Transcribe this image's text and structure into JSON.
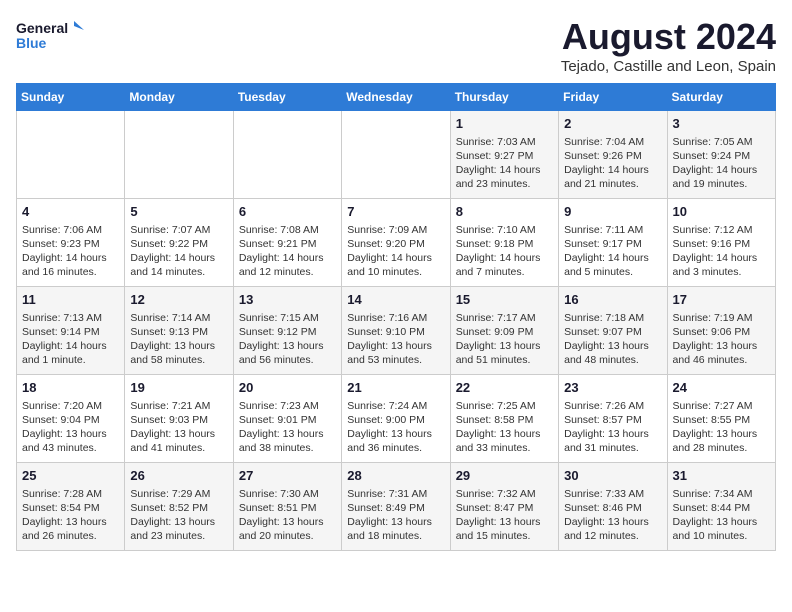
{
  "logo": {
    "line1": "General",
    "line2": "Blue"
  },
  "title": "August 2024",
  "subtitle": "Tejado, Castille and Leon, Spain",
  "days_of_week": [
    "Sunday",
    "Monday",
    "Tuesday",
    "Wednesday",
    "Thursday",
    "Friday",
    "Saturday"
  ],
  "weeks": [
    [
      {
        "day": "",
        "content": ""
      },
      {
        "day": "",
        "content": ""
      },
      {
        "day": "",
        "content": ""
      },
      {
        "day": "",
        "content": ""
      },
      {
        "day": "1",
        "content": "Sunrise: 7:03 AM\nSunset: 9:27 PM\nDaylight: 14 hours\nand 23 minutes."
      },
      {
        "day": "2",
        "content": "Sunrise: 7:04 AM\nSunset: 9:26 PM\nDaylight: 14 hours\nand 21 minutes."
      },
      {
        "day": "3",
        "content": "Sunrise: 7:05 AM\nSunset: 9:24 PM\nDaylight: 14 hours\nand 19 minutes."
      }
    ],
    [
      {
        "day": "4",
        "content": "Sunrise: 7:06 AM\nSunset: 9:23 PM\nDaylight: 14 hours\nand 16 minutes."
      },
      {
        "day": "5",
        "content": "Sunrise: 7:07 AM\nSunset: 9:22 PM\nDaylight: 14 hours\nand 14 minutes."
      },
      {
        "day": "6",
        "content": "Sunrise: 7:08 AM\nSunset: 9:21 PM\nDaylight: 14 hours\nand 12 minutes."
      },
      {
        "day": "7",
        "content": "Sunrise: 7:09 AM\nSunset: 9:20 PM\nDaylight: 14 hours\nand 10 minutes."
      },
      {
        "day": "8",
        "content": "Sunrise: 7:10 AM\nSunset: 9:18 PM\nDaylight: 14 hours\nand 7 minutes."
      },
      {
        "day": "9",
        "content": "Sunrise: 7:11 AM\nSunset: 9:17 PM\nDaylight: 14 hours\nand 5 minutes."
      },
      {
        "day": "10",
        "content": "Sunrise: 7:12 AM\nSunset: 9:16 PM\nDaylight: 14 hours\nand 3 minutes."
      }
    ],
    [
      {
        "day": "11",
        "content": "Sunrise: 7:13 AM\nSunset: 9:14 PM\nDaylight: 14 hours\nand 1 minute."
      },
      {
        "day": "12",
        "content": "Sunrise: 7:14 AM\nSunset: 9:13 PM\nDaylight: 13 hours\nand 58 minutes."
      },
      {
        "day": "13",
        "content": "Sunrise: 7:15 AM\nSunset: 9:12 PM\nDaylight: 13 hours\nand 56 minutes."
      },
      {
        "day": "14",
        "content": "Sunrise: 7:16 AM\nSunset: 9:10 PM\nDaylight: 13 hours\nand 53 minutes."
      },
      {
        "day": "15",
        "content": "Sunrise: 7:17 AM\nSunset: 9:09 PM\nDaylight: 13 hours\nand 51 minutes."
      },
      {
        "day": "16",
        "content": "Sunrise: 7:18 AM\nSunset: 9:07 PM\nDaylight: 13 hours\nand 48 minutes."
      },
      {
        "day": "17",
        "content": "Sunrise: 7:19 AM\nSunset: 9:06 PM\nDaylight: 13 hours\nand 46 minutes."
      }
    ],
    [
      {
        "day": "18",
        "content": "Sunrise: 7:20 AM\nSunset: 9:04 PM\nDaylight: 13 hours\nand 43 minutes."
      },
      {
        "day": "19",
        "content": "Sunrise: 7:21 AM\nSunset: 9:03 PM\nDaylight: 13 hours\nand 41 minutes."
      },
      {
        "day": "20",
        "content": "Sunrise: 7:23 AM\nSunset: 9:01 PM\nDaylight: 13 hours\nand 38 minutes."
      },
      {
        "day": "21",
        "content": "Sunrise: 7:24 AM\nSunset: 9:00 PM\nDaylight: 13 hours\nand 36 minutes."
      },
      {
        "day": "22",
        "content": "Sunrise: 7:25 AM\nSunset: 8:58 PM\nDaylight: 13 hours\nand 33 minutes."
      },
      {
        "day": "23",
        "content": "Sunrise: 7:26 AM\nSunset: 8:57 PM\nDaylight: 13 hours\nand 31 minutes."
      },
      {
        "day": "24",
        "content": "Sunrise: 7:27 AM\nSunset: 8:55 PM\nDaylight: 13 hours\nand 28 minutes."
      }
    ],
    [
      {
        "day": "25",
        "content": "Sunrise: 7:28 AM\nSunset: 8:54 PM\nDaylight: 13 hours\nand 26 minutes."
      },
      {
        "day": "26",
        "content": "Sunrise: 7:29 AM\nSunset: 8:52 PM\nDaylight: 13 hours\nand 23 minutes."
      },
      {
        "day": "27",
        "content": "Sunrise: 7:30 AM\nSunset: 8:51 PM\nDaylight: 13 hours\nand 20 minutes."
      },
      {
        "day": "28",
        "content": "Sunrise: 7:31 AM\nSunset: 8:49 PM\nDaylight: 13 hours\nand 18 minutes."
      },
      {
        "day": "29",
        "content": "Sunrise: 7:32 AM\nSunset: 8:47 PM\nDaylight: 13 hours\nand 15 minutes."
      },
      {
        "day": "30",
        "content": "Sunrise: 7:33 AM\nSunset: 8:46 PM\nDaylight: 13 hours\nand 12 minutes."
      },
      {
        "day": "31",
        "content": "Sunrise: 7:34 AM\nSunset: 8:44 PM\nDaylight: 13 hours\nand 10 minutes."
      }
    ]
  ]
}
